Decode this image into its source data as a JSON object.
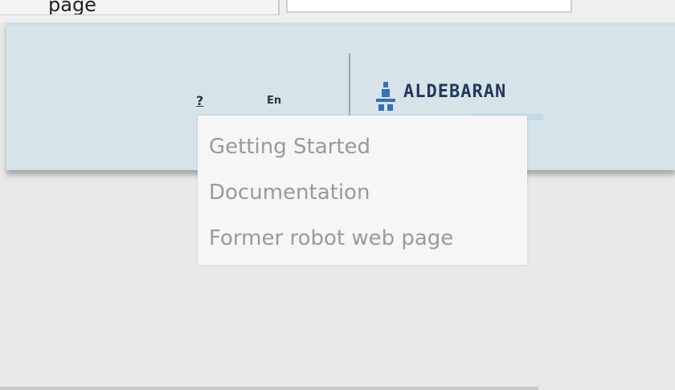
{
  "top": {
    "fragment_text": "page"
  },
  "header": {
    "help_label": "?",
    "language_label": "En",
    "logo_text": "ALDEBARAN"
  },
  "dropdown": {
    "items": [
      {
        "label": "Getting Started"
      },
      {
        "label": "Documentation"
      },
      {
        "label": "Former robot web page"
      }
    ]
  },
  "colors": {
    "header_bg": "#d6e4ea",
    "page_bg": "#e8e8e8",
    "menu_text": "#9a9a9a",
    "logo": "#23395b",
    "logo_accent": "#3a6fb0"
  }
}
